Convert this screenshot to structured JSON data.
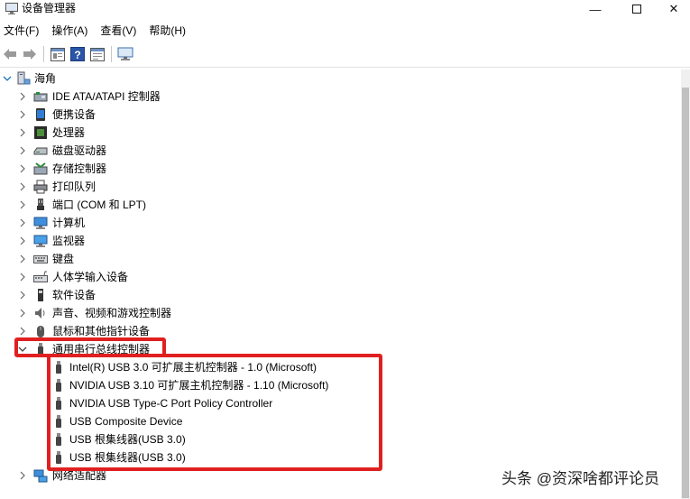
{
  "window": {
    "title": "设备管理器",
    "minimize_glyph": "—",
    "close_glyph": "✕"
  },
  "menu": [
    "文件(F)",
    "操作(A)",
    "查看(V)",
    "帮助(H)"
  ],
  "toolbar": {
    "buttons": [
      "back-arrow-icon",
      "forward-arrow-icon",
      "properties-icon",
      "help-icon",
      "view-icon",
      "monitor-icon"
    ]
  },
  "tree": {
    "root": "海角",
    "categories": [
      {
        "label": "IDE ATA/ATAPI 控制器",
        "icon": "ide-controller-icon"
      },
      {
        "label": "便携设备",
        "icon": "portable-device-icon"
      },
      {
        "label": "处理器",
        "icon": "processor-icon"
      },
      {
        "label": "磁盘驱动器",
        "icon": "disk-drive-icon"
      },
      {
        "label": "存储控制器",
        "icon": "storage-controller-icon"
      },
      {
        "label": "打印队列",
        "icon": "printer-icon"
      },
      {
        "label": "端口 (COM 和 LPT)",
        "icon": "port-icon"
      },
      {
        "label": "计算机",
        "icon": "computer-icon"
      },
      {
        "label": "监视器",
        "icon": "monitor-icon"
      },
      {
        "label": "键盘",
        "icon": "keyboard-icon"
      },
      {
        "label": "人体学输入设备",
        "icon": "hid-icon"
      },
      {
        "label": "软件设备",
        "icon": "software-device-icon"
      },
      {
        "label": "声音、视频和游戏控制器",
        "icon": "sound-icon"
      },
      {
        "label": "鼠标和其他指针设备",
        "icon": "mouse-icon"
      },
      {
        "label": "通用串行总线控制器",
        "icon": "usb-icon"
      }
    ],
    "usb_children": [
      "Intel(R) USB 3.0 可扩展主机控制器 - 1.0 (Microsoft)",
      "NVIDIA USB 3.10 可扩展主机控制器 - 1.10 (Microsoft)",
      "NVIDIA USB Type-C Port Policy Controller",
      "USB Composite Device",
      "USB 根集线器(USB 3.0)",
      "USB 根集线器(USB 3.0)"
    ],
    "after": {
      "label": "网络适配器",
      "icon": "network-adapter-icon"
    }
  },
  "watermark": "头条 @资深啥都评论员",
  "colors": {
    "highlight": "#e02020",
    "icon_blue": "#1e73be"
  }
}
